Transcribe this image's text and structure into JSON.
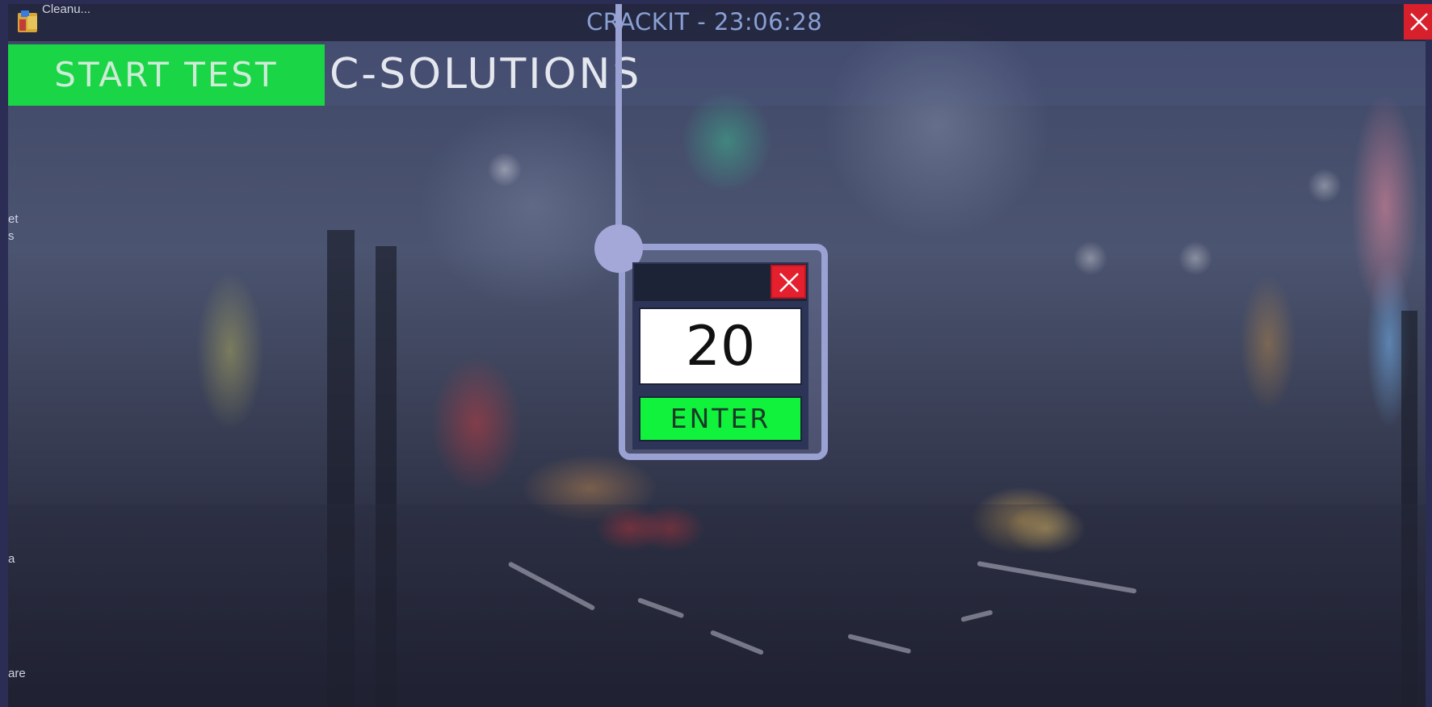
{
  "window": {
    "title": "CRACKIT - 23:06:28",
    "close_icon": "close-icon"
  },
  "taskbar": {
    "app_label": "Cleanu...",
    "icon": "folder-app-icon"
  },
  "desktop_fragments": [
    "et",
    "s",
    "a",
    "are"
  ],
  "header": {
    "start_button_label": "START TEST",
    "brand": "C-SOLUTIONS"
  },
  "popup": {
    "close_icon": "close-icon",
    "input_value": "20",
    "enter_label": "ENTER"
  },
  "colors": {
    "accent_green": "#1ad545",
    "enter_green": "#10f23b",
    "close_red": "#e4202f",
    "outline_lavender": "#9aa1d3"
  }
}
